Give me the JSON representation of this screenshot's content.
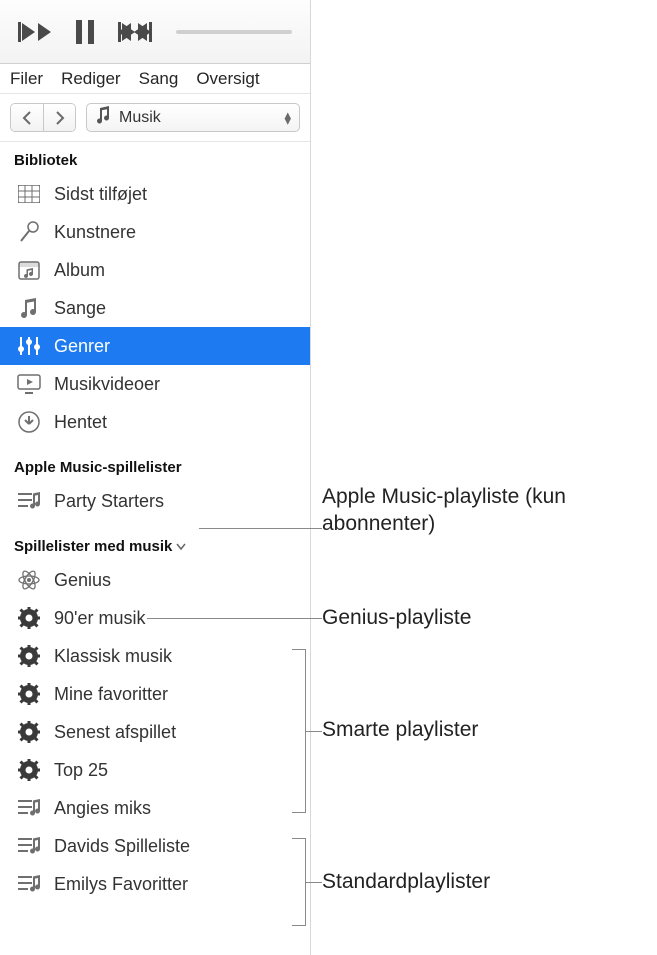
{
  "menu": {
    "file": "Filer",
    "edit": "Rediger",
    "song": "Sang",
    "view": "Oversigt"
  },
  "source": {
    "label": "Musik"
  },
  "library": {
    "header": "Bibliotek",
    "items": [
      {
        "icon": "grid",
        "label": "Sidst tilføjet",
        "selected": false
      },
      {
        "icon": "mic",
        "label": "Kunstnere",
        "selected": false
      },
      {
        "icon": "album",
        "label": "Album",
        "selected": false
      },
      {
        "icon": "note",
        "label": "Sange",
        "selected": false
      },
      {
        "icon": "tuning",
        "label": "Genrer",
        "selected": true
      },
      {
        "icon": "screen",
        "label": "Musikvideoer",
        "selected": false
      },
      {
        "icon": "download",
        "label": "Hentet",
        "selected": false
      }
    ]
  },
  "amPlaylists": {
    "header": "Apple Music-spillelister",
    "items": [
      {
        "icon": "playlist",
        "label": "Party Starters"
      }
    ]
  },
  "musicPlaylists": {
    "header": "Spillelister med musik",
    "items": [
      {
        "icon": "genius",
        "label": "Genius"
      },
      {
        "icon": "gear",
        "label": "90'er musik"
      },
      {
        "icon": "gear",
        "label": "Klassisk musik"
      },
      {
        "icon": "gear",
        "label": "Mine favoritter"
      },
      {
        "icon": "gear",
        "label": "Senest afspillet"
      },
      {
        "icon": "gear",
        "label": "Top 25"
      },
      {
        "icon": "playlist",
        "label": "Angies miks"
      },
      {
        "icon": "playlist",
        "label": "Davids Spilleliste"
      },
      {
        "icon": "playlist",
        "label": "Emilys Favoritter"
      }
    ]
  },
  "callouts": {
    "apple": "Apple Music-playliste (kun abonnenter)",
    "genius": "Genius-playliste",
    "smart": "Smarte playlister",
    "standard": "Standardplaylister"
  }
}
